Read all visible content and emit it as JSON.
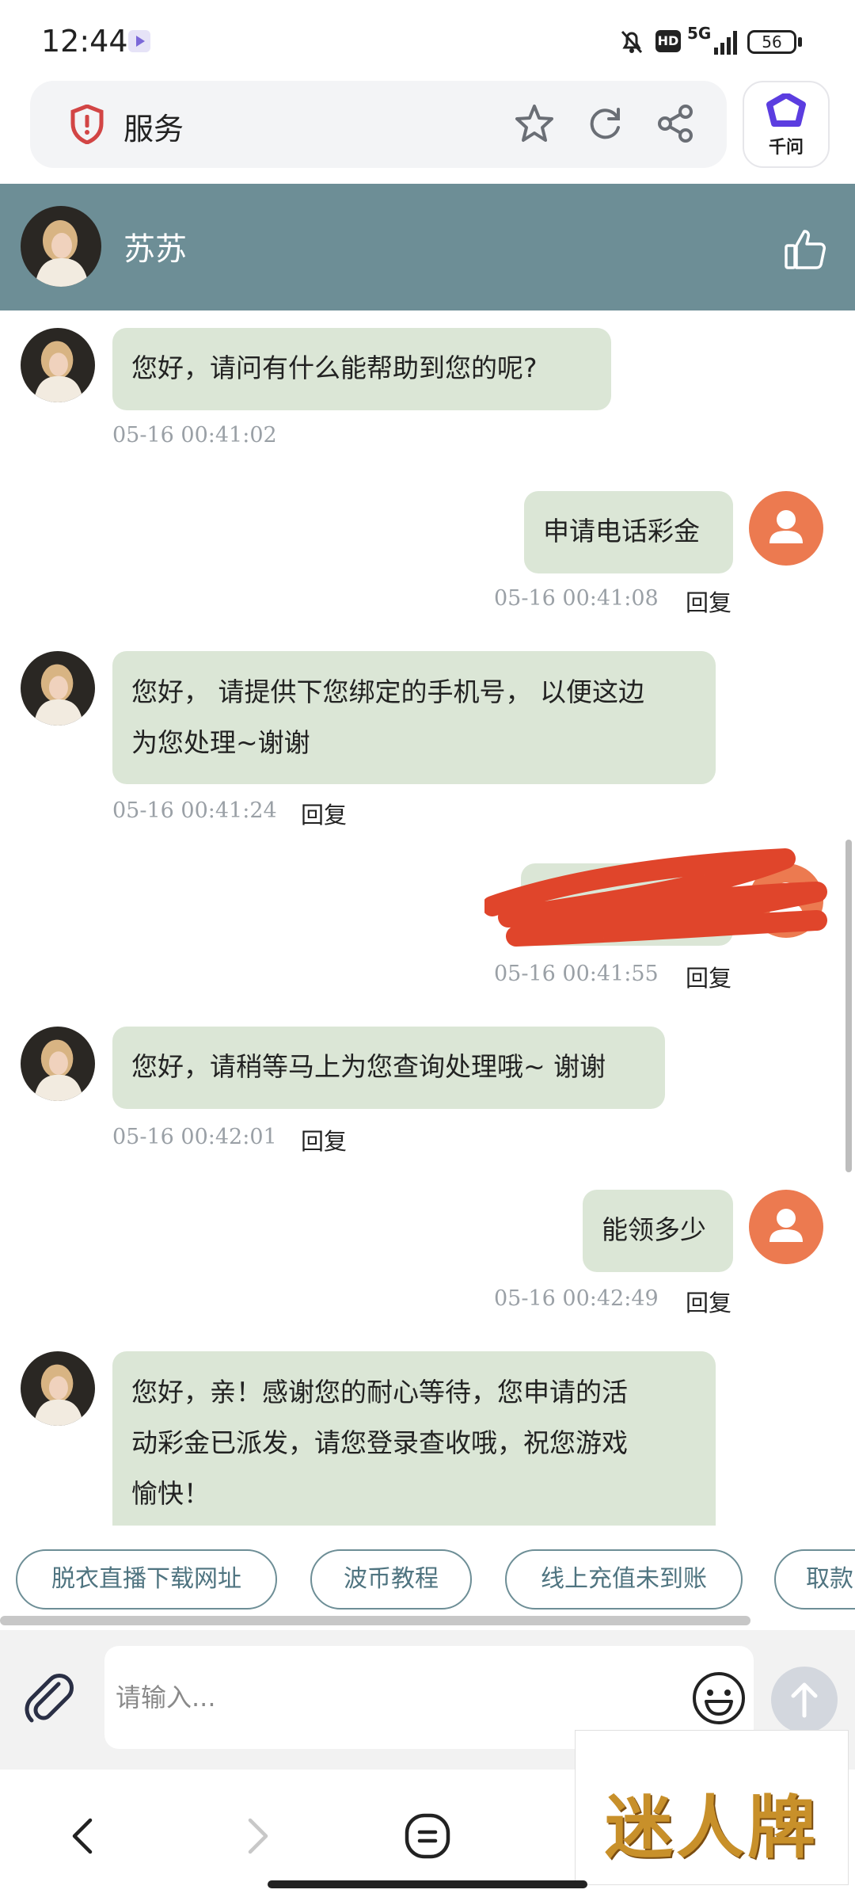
{
  "status_bar": {
    "time": "12:44",
    "network": "5G",
    "hd": "HD",
    "battery": "56"
  },
  "browser": {
    "title": "服务",
    "qianwen_label": "千问"
  },
  "chat": {
    "agent_name": "苏苏",
    "reply_label": "回复",
    "messages": [
      {
        "sender": "agent",
        "text": "您好，请问有什么能帮助到您的呢?",
        "time": "05-16 00:41:02"
      },
      {
        "sender": "user",
        "text": "申请电话彩金",
        "time": "05-16 00:41:08"
      },
      {
        "sender": "agent",
        "lines": [
          "您好， 请提供下您绑定的手机号， 以便这边",
          "为您处理~谢谢"
        ],
        "time": "05-16 00:41:24"
      },
      {
        "sender": "user",
        "text": "",
        "time": "05-16 00:41:55",
        "redacted": true
      },
      {
        "sender": "agent",
        "text": "您好，请稍等马上为您查询处理哦~ 谢谢",
        "time": "05-16 00:42:01"
      },
      {
        "sender": "user",
        "text": "能领多少",
        "time": "05-16 00:42:49"
      },
      {
        "sender": "agent",
        "lines": [
          "您好，亲！感谢您的耐心等待，您申请的活",
          "动彩金已派发，请您登录查收哦，祝您游戏",
          "愉快！"
        ]
      }
    ]
  },
  "quick_replies": [
    "脱衣直播下载网址",
    "波币教程",
    "线上充值未到账",
    "取款"
  ],
  "input": {
    "placeholder": "请输入..."
  },
  "watermark": {
    "text": "迷人牌"
  },
  "colors": {
    "header": "#6d8e96",
    "bubble": "#dbe6d6",
    "user_avatar": "#ec7a50",
    "redaction": "#e0452b"
  }
}
